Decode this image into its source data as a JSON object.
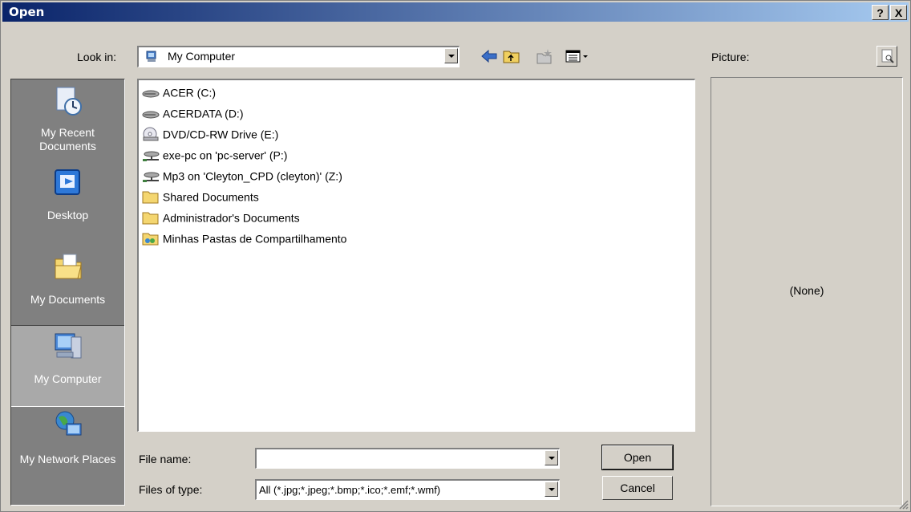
{
  "window": {
    "title": "Open",
    "help_label": "?",
    "close_label": "X"
  },
  "toolbar": {
    "look_in_label": "Look in:",
    "look_in_value": "My Computer",
    "icons": [
      "back-icon",
      "up-folder-icon",
      "new-folder-icon",
      "views-menu-icon"
    ]
  },
  "places": [
    {
      "label": "My Recent Documents",
      "icon": "recent-documents-icon",
      "selected": false
    },
    {
      "label": "Desktop",
      "icon": "desktop-icon",
      "selected": false
    },
    {
      "label": "My Documents",
      "icon": "my-documents-icon",
      "selected": false
    },
    {
      "label": "My Computer",
      "icon": "my-computer-icon",
      "selected": true
    },
    {
      "label": "My Network Places",
      "icon": "network-places-icon",
      "selected": false
    }
  ],
  "files": [
    {
      "label": "ACER (C:)",
      "icon": "hard-drive-icon"
    },
    {
      "label": "ACERDATA (D:)",
      "icon": "hard-drive-icon"
    },
    {
      "label": "DVD/CD-RW Drive (E:)",
      "icon": "dvd-drive-icon"
    },
    {
      "label": "exe-pc on 'pc-server' (P:)",
      "icon": "network-drive-icon"
    },
    {
      "label": "Mp3 on 'Cleyton_CPD (cleyton)' (Z:)",
      "icon": "network-drive-icon"
    },
    {
      "label": "Shared Documents",
      "icon": "folder-icon"
    },
    {
      "label": "Administrador's Documents",
      "icon": "folder-icon"
    },
    {
      "label": "Minhas Pastas de Compartilhamento",
      "icon": "shared-folder-icon"
    }
  ],
  "preview": {
    "label": "Picture:",
    "value": "(None)"
  },
  "form": {
    "file_name_label": "File name:",
    "file_name_value": "",
    "file_type_label": "Files of type:",
    "file_type_value": "All (*.jpg;*.jpeg;*.bmp;*.ico;*.emf;*.wmf)",
    "open_label": "Open",
    "cancel_label": "Cancel"
  },
  "colors": {
    "title_start": "#0a246a",
    "title_end": "#a6caf0",
    "face": "#d4d0c8",
    "places_bg": "#808080"
  }
}
